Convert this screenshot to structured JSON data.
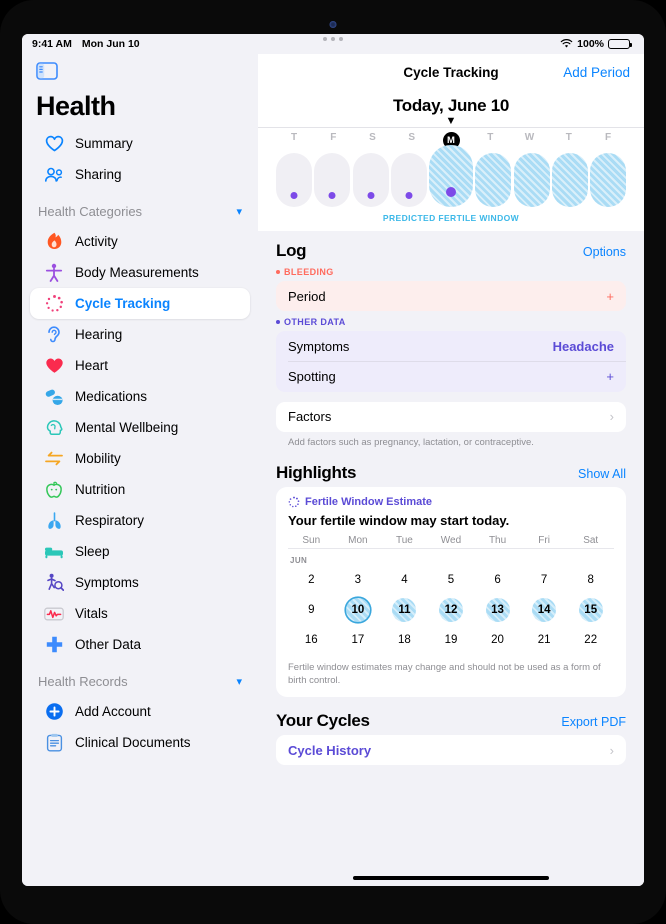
{
  "status_bar": {
    "time": "9:41 AM",
    "date": "Mon Jun 10",
    "battery": "100%",
    "wifi_icon": "wifi-icon",
    "battery_icon": "battery-icon"
  },
  "sidebar": {
    "toggle_icon": "sidebar-toggle-icon",
    "app_title": "Health",
    "top_items": [
      {
        "label": "Summary",
        "icon": "heart-outline-icon",
        "color": "#0a84ff"
      },
      {
        "label": "Sharing",
        "icon": "people-icon",
        "color": "#0a84ff"
      }
    ],
    "categories_section": {
      "title": "Health Categories",
      "chevron": "chevron-down-icon",
      "items": [
        {
          "label": "Activity",
          "icon": "flame-icon",
          "color": "#ff5722"
        },
        {
          "label": "Body Measurements",
          "icon": "body-figure-icon",
          "color": "#9b4fe0"
        },
        {
          "label": "Cycle Tracking",
          "icon": "cycle-dots-icon",
          "color": "#f0407a",
          "selected": true
        },
        {
          "label": "Hearing",
          "icon": "ear-icon",
          "color": "#3d8bfd"
        },
        {
          "label": "Heart",
          "icon": "heart-filled-icon",
          "color": "#fa2b4e"
        },
        {
          "label": "Medications",
          "icon": "pills-icon",
          "color": "#35a7e8"
        },
        {
          "label": "Mental Wellbeing",
          "icon": "head-icon",
          "color": "#2bc7b8"
        },
        {
          "label": "Mobility",
          "icon": "arrows-icon",
          "color": "#f5a623"
        },
        {
          "label": "Nutrition",
          "icon": "apple-icon",
          "color": "#34c759"
        },
        {
          "label": "Respiratory",
          "icon": "lungs-icon",
          "color": "#3aa7f0"
        },
        {
          "label": "Sleep",
          "icon": "bed-icon",
          "color": "#2bc7b8"
        },
        {
          "label": "Symptoms",
          "icon": "person-magnifier-icon",
          "color": "#5546c4"
        },
        {
          "label": "Vitals",
          "icon": "waveform-icon",
          "color": "#fa2b4e"
        },
        {
          "label": "Other Data",
          "icon": "plus-cross-icon",
          "color": "#3d8bfd"
        }
      ]
    },
    "records_section": {
      "title": "Health Records",
      "chevron": "chevron-down-icon",
      "items": [
        {
          "label": "Add Account",
          "icon": "add-circle-icon",
          "color": "#0a6ef0"
        },
        {
          "label": "Clinical Documents",
          "icon": "clipboard-icon",
          "color": "#4a90e2"
        }
      ]
    }
  },
  "detail": {
    "nav": {
      "title": "Cycle Tracking",
      "action_label": "Add Period"
    },
    "today": {
      "label": "Today, June 10",
      "caret": "caret-down-icon"
    },
    "cycle_strip": {
      "days": [
        {
          "dow": "T",
          "type": "logged",
          "dot": true,
          "today": false
        },
        {
          "dow": "F",
          "type": "logged",
          "dot": true,
          "today": false
        },
        {
          "dow": "S",
          "type": "logged",
          "dot": true,
          "today": false
        },
        {
          "dow": "S",
          "type": "logged",
          "dot": true,
          "today": false
        },
        {
          "dow": "M",
          "type": "fertile",
          "dot": true,
          "today": true
        },
        {
          "dow": "T",
          "type": "fertile",
          "dot": false,
          "today": false
        },
        {
          "dow": "W",
          "type": "fertile",
          "dot": false,
          "today": false
        },
        {
          "dow": "T",
          "type": "fertile",
          "dot": false,
          "today": false
        },
        {
          "dow": "F",
          "type": "fertile",
          "dot": false,
          "today": false
        }
      ],
      "fertile_label": "PREDICTED FERTILE WINDOW",
      "fertile_color": "#3cb8e8"
    },
    "log": {
      "title": "Log",
      "options_label": "Options",
      "bleeding_tag": "BLEEDING",
      "bleeding_color": "#ff6b5e",
      "bleeding_rows": [
        {
          "label": "Period",
          "value": "+",
          "kind": "plus"
        }
      ],
      "other_tag": "OTHER DATA",
      "other_color": "#5b4bd6",
      "other_rows": [
        {
          "label": "Symptoms",
          "value": "Headache",
          "kind": "value"
        },
        {
          "label": "Spotting",
          "value": "+",
          "kind": "plus"
        }
      ],
      "factors_row": {
        "label": "Factors",
        "chevron": "chevron-right-icon"
      },
      "factors_note": "Add factors such as pregnancy, lactation, or contraceptive."
    },
    "highlights": {
      "title": "Highlights",
      "show_all_label": "Show All",
      "card": {
        "kicker": "Fertile Window Estimate",
        "kicker_icon": "cycle-dots-icon",
        "headline": "Your fertile window may start today.",
        "dow_labels": [
          "Sun",
          "Mon",
          "Tue",
          "Wed",
          "Thu",
          "Fri",
          "Sat"
        ],
        "month_label": "JUN",
        "weeks": [
          [
            {
              "n": "2"
            },
            {
              "n": "3"
            },
            {
              "n": "4"
            },
            {
              "n": "5"
            },
            {
              "n": "6"
            },
            {
              "n": "7"
            },
            {
              "n": "8"
            }
          ],
          [
            {
              "n": "9"
            },
            {
              "n": "10",
              "highlight": true,
              "today": true
            },
            {
              "n": "11",
              "highlight": true
            },
            {
              "n": "12",
              "highlight": true
            },
            {
              "n": "13",
              "highlight": true
            },
            {
              "n": "14",
              "highlight": true
            },
            {
              "n": "15",
              "highlight": true
            }
          ],
          [
            {
              "n": "16"
            },
            {
              "n": "17"
            },
            {
              "n": "18"
            },
            {
              "n": "19"
            },
            {
              "n": "20"
            },
            {
              "n": "21"
            },
            {
              "n": "22"
            }
          ]
        ],
        "note": "Fertile window estimates may change and should not be used as a form of birth control."
      }
    },
    "your_cycles": {
      "title": "Your Cycles",
      "export_label": "Export PDF",
      "rows": [
        {
          "label": "Cycle History",
          "chevron": "chevron-right-icon"
        }
      ]
    }
  }
}
